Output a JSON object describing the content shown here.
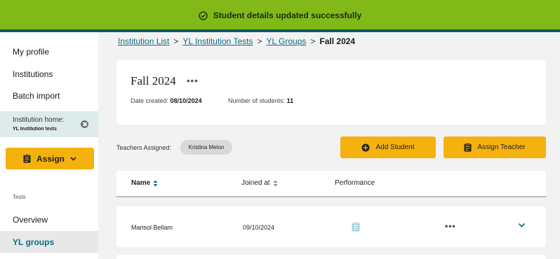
{
  "toast": {
    "message": "Student details updated successfully",
    "icon": "check-circle-icon",
    "color": "#80b918",
    "accent": "#0d5c63"
  },
  "sidebar": {
    "items": [
      {
        "label": "My profile"
      },
      {
        "label": "Institutions"
      },
      {
        "label": "Batch import"
      }
    ],
    "institution_home": {
      "label": "Institution home:",
      "name": "YL Institution tests"
    },
    "assign_label": "Assign",
    "tests_section": "Tests",
    "overview_label": "Overview",
    "active_item": "YL groups"
  },
  "breadcrumb": {
    "links": [
      "Institution List",
      "YL Institution Tests",
      "YL Groups"
    ],
    "current": "Fall 2024",
    "separator": ">"
  },
  "group": {
    "title": "Fall 2024",
    "date_created_label": "Date created:",
    "date_created": "08/10/2024",
    "students_label": "Number of students:",
    "students_count": "11"
  },
  "teachers": {
    "label": "Teachers Assigned:",
    "names": [
      "Kristina Melon"
    ]
  },
  "actions": {
    "add_student": "Add Student",
    "assign_teacher": "Assign Teacher"
  },
  "table": {
    "headers": [
      "Name",
      "Joined at",
      "Performance"
    ],
    "rows": [
      {
        "name": "Marisol Bellam",
        "joined": "09/10/2024"
      }
    ]
  },
  "colors": {
    "brand": "#0b6e83",
    "button": "#f5b10e"
  }
}
